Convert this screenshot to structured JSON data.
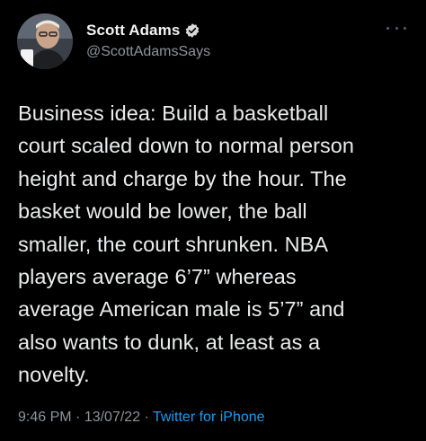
{
  "author": {
    "display_name": "Scott Adams",
    "handle": "@ScottAdamsSays",
    "verified_icon": "verified-badge-icon",
    "avatar_icon": "profile-photo"
  },
  "tweet": {
    "text": "Business idea: Build a basketball\ncourt scaled down to normal person\nheight and charge by the hour. The\nbasket would be lower, the ball\nsmaller, the court shrunken. NBA\nplayers average 6’7” whereas\naverage American male is 5’7” and\nalso wants to dunk, at least as a\nnovelty."
  },
  "meta": {
    "time": "9:46 PM",
    "separator": " · ",
    "date": "13/07/22",
    "separator2": " · ",
    "source": "Twitter for iPhone"
  },
  "more_icon": "more-options-icon",
  "colors": {
    "background": "#000000",
    "text": "#e7e9ea",
    "secondary": "#8b949c",
    "accent": "#1d9bf0"
  }
}
